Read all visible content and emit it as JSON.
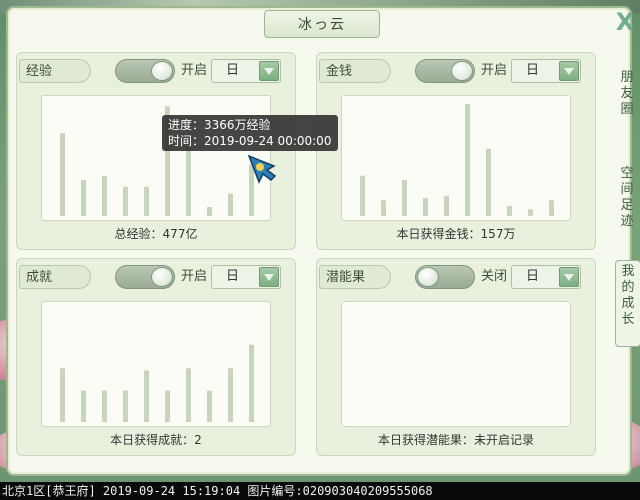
{
  "window": {
    "title": "冰っ云",
    "close_label": "X"
  },
  "side_tabs": [
    {
      "label": "朋友圈",
      "chars": [
        "朋",
        "友",
        "圈"
      ]
    },
    {
      "label": "空间足迹",
      "chars": [
        "空",
        "间",
        "足",
        "迹"
      ]
    },
    {
      "label": "我的成长",
      "chars": [
        "我",
        "的",
        "成",
        "长"
      ]
    }
  ],
  "panels": {
    "exp": {
      "tag": "经验",
      "toggle_state": "on",
      "toggle_label": "开启",
      "select_value": "日",
      "caption": "总经验：477亿"
    },
    "money": {
      "tag": "金钱",
      "toggle_state": "on",
      "toggle_label": "开启",
      "select_value": "日",
      "caption": "本日获得金钱：157万"
    },
    "ach": {
      "tag": "成就",
      "toggle_state": "on",
      "toggle_label": "开启",
      "select_value": "日",
      "caption": "本日获得成就：2"
    },
    "pot": {
      "tag": "潜能果",
      "toggle_state": "off",
      "toggle_label": "关闭",
      "select_value": "日",
      "caption": "本日获得潜能果：未开启记录"
    }
  },
  "tooltip": {
    "line1": "进度：3366万经验",
    "line2": "时间：2019-09-24 00:00:00"
  },
  "colors": {
    "bar": "#c9d4bd",
    "accent": "#7fae82",
    "panel_bg": "#e9f1de"
  },
  "chart_data": [
    {
      "panel": "exp",
      "type": "bar",
      "values": [
        0.74,
        0.32,
        0.36,
        0.26,
        0.26,
        0.98,
        0.62,
        0.08,
        0.2,
        0.46
      ]
    },
    {
      "panel": "money",
      "type": "bar",
      "values": [
        0.36,
        0.14,
        0.32,
        0.16,
        0.18,
        1.0,
        0.6,
        0.09,
        0.06,
        0.14
      ]
    },
    {
      "panel": "ach",
      "type": "bar",
      "values": [
        0.48,
        0.28,
        0.28,
        0.28,
        0.46,
        0.28,
        0.48,
        0.28,
        0.48,
        0.69
      ]
    },
    {
      "panel": "pot",
      "type": "bar",
      "values": []
    }
  ],
  "status_bar": "北京1区[恭王府] 2019-09-24 15:19:04 图片编号:020903040209555068"
}
